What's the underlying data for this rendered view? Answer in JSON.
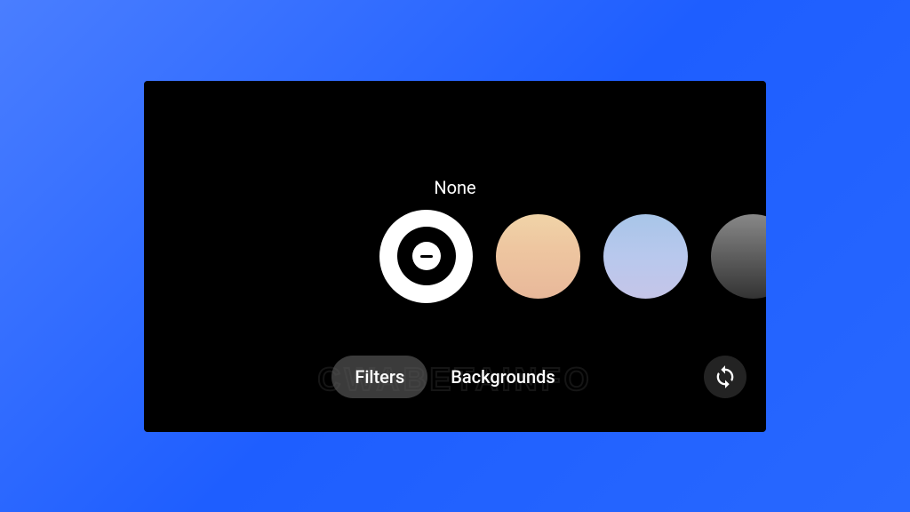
{
  "filter": {
    "selected_label": "None"
  },
  "toggle": {
    "filters_label": "Filters",
    "backgrounds_label": "Backgrounds"
  },
  "watermark": {
    "text": "CWABETAINFO"
  }
}
